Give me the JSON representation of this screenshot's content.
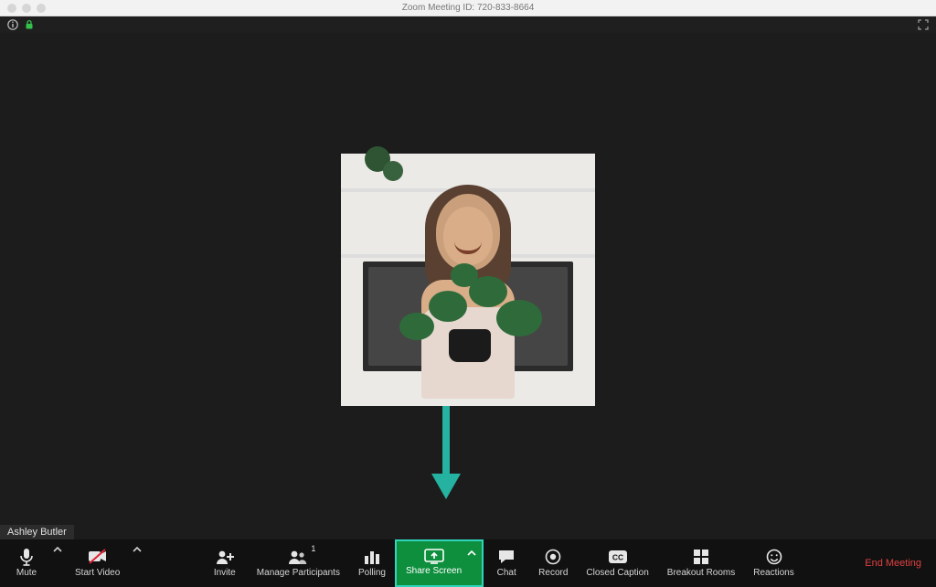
{
  "window": {
    "title": "Zoom Meeting ID: 720-833-8664"
  },
  "topbar": {
    "info_icon": "info",
    "encryption_icon": "lock",
    "fullscreen_icon": "fullscreen"
  },
  "participant": {
    "name": "Ashley Butler"
  },
  "toolbar": {
    "mute": {
      "label": "Mute"
    },
    "video": {
      "label": "Start Video"
    },
    "invite": {
      "label": "Invite"
    },
    "participants": {
      "label": "Manage Participants",
      "count": "1"
    },
    "polling": {
      "label": "Polling"
    },
    "share": {
      "label": "Share Screen"
    },
    "chat": {
      "label": "Chat"
    },
    "record": {
      "label": "Record"
    },
    "cc": {
      "label": "Closed Caption"
    },
    "breakout": {
      "label": "Breakout Rooms"
    },
    "reactions": {
      "label": "Reactions"
    },
    "end": {
      "label": "End Meeting"
    }
  },
  "colors": {
    "share_green": "#0e8f3d",
    "highlight_teal": "#2fd4bd",
    "end_red": "#e04040"
  }
}
